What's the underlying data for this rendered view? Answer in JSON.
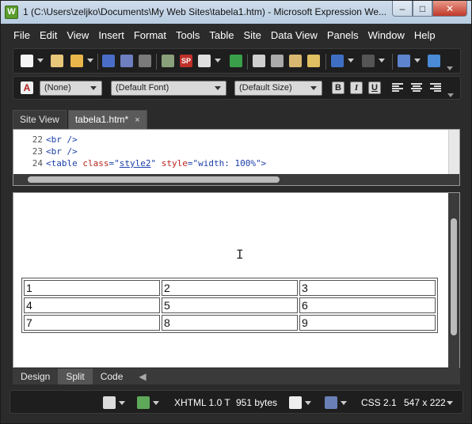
{
  "window": {
    "title": "1 (C:\\Users\\zeljko\\Documents\\My Web Sites\\tabela1.htm) - Microsoft Expression We...",
    "app_icon": "W"
  },
  "menu": [
    "File",
    "Edit",
    "View",
    "Insert",
    "Format",
    "Tools",
    "Table",
    "Site",
    "Data View",
    "Panels",
    "Window",
    "Help"
  ],
  "format_toolbar": {
    "style": "(None)",
    "font": "(Default Font)",
    "size": "(Default Size)",
    "bold": "B",
    "italic": "I",
    "underline": "U",
    "style_icon": "A"
  },
  "tabs": [
    {
      "label": "Site View"
    },
    {
      "label": "tabela1.htm*",
      "close": "×"
    }
  ],
  "code": [
    {
      "n": "22",
      "text": "<br />"
    },
    {
      "n": "23",
      "text": "<br />"
    },
    {
      "n": "24",
      "t1": "<table ",
      "a1": "class",
      "eq": "=\"",
      "v1": "style2",
      "q": "\" ",
      "a2": "style",
      "v2": "\"width: 100%\"",
      "end": ">"
    }
  ],
  "table_cells": [
    [
      "1",
      "2",
      "3"
    ],
    [
      "4",
      "5",
      "6"
    ],
    [
      "7",
      "8",
      "9"
    ]
  ],
  "view_tabs": [
    "Design",
    "Split",
    "Code"
  ],
  "status": {
    "doctype": "XHTML 1.0 T",
    "size": "951 bytes",
    "css": "CSS 2.1",
    "dims": "547 x 222"
  },
  "colors": {
    "titlebar": "#c6d6e8",
    "chrome": "#2b2b2b",
    "close": "#c0392b"
  }
}
